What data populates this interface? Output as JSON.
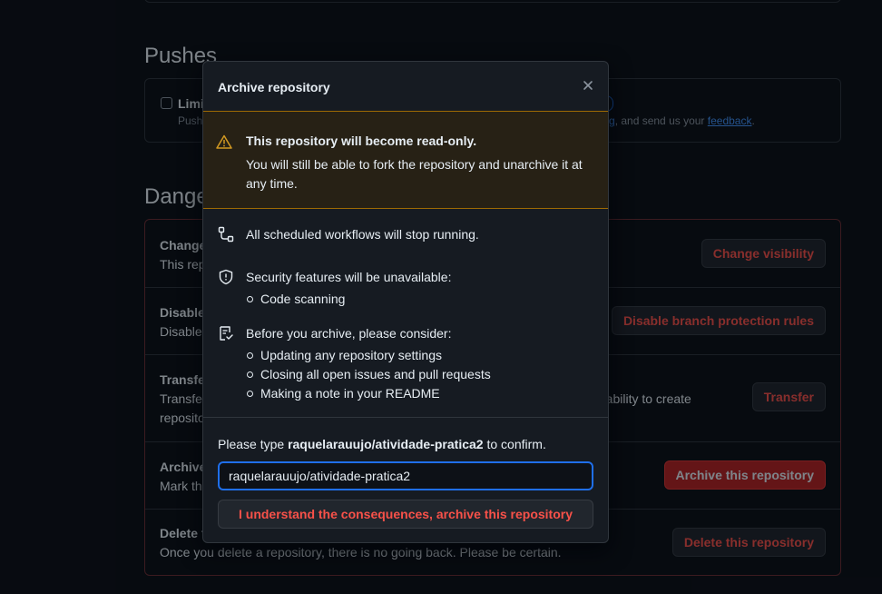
{
  "background": {
    "pushes_title": "Pushes",
    "pushes_option_label": "Limi",
    "pushes_option_desc": "Pushe",
    "pushes_right_link1": "tting",
    "pushes_right_mid": ", and send us your ",
    "pushes_right_link2": "feedback",
    "pushes_right_end": ".",
    "danger_title": "Dange",
    "rows": [
      {
        "title": "Change",
        "desc": "This rep",
        "button": "Change visibility"
      },
      {
        "title": "Disable",
        "desc": "Disable",
        "button": "Disable branch protection rules"
      },
      {
        "title": "Transfer",
        "desc": "Transfer",
        "desc2": "reposito",
        "desc_right": "e ability to create",
        "button": "Transfer"
      },
      {
        "title": "Archive",
        "desc": "Mark th",
        "button": "Archive this repository"
      },
      {
        "title": "Delete t",
        "desc": "Once you delete a repository, there is no going back. Please be certain.",
        "button": "Delete this repository"
      }
    ]
  },
  "dialog": {
    "title": "Archive repository",
    "close_icon": "x-icon",
    "warning": {
      "title": "This repository will become read-only.",
      "text": "You will still be able to fork the repository and unarchive it at any time."
    },
    "items": [
      {
        "icon": "workflow-icon",
        "text": "All scheduled workflows will stop running."
      },
      {
        "icon": "shield-icon",
        "text": "Security features will be unavailable:",
        "bullets": [
          "Code scanning"
        ]
      },
      {
        "icon": "checklist-icon",
        "text": "Before you archive, please consider:",
        "bullets": [
          "Updating any repository settings",
          "Closing all open issues and pull requests",
          "Making a note in your README"
        ]
      }
    ],
    "confirm": {
      "prefix": "Please type ",
      "repo": "raquelarauujo/atividade-pratica2",
      "suffix": " to confirm.",
      "input_value": "raquelarauujo/atividade-pratica2",
      "button": "I understand the consequences, archive this repository"
    }
  },
  "colors": {
    "danger": "#f85149",
    "accent": "#1f6feb",
    "warning_bg": "#272115",
    "warning_border": "#9e6a03"
  }
}
